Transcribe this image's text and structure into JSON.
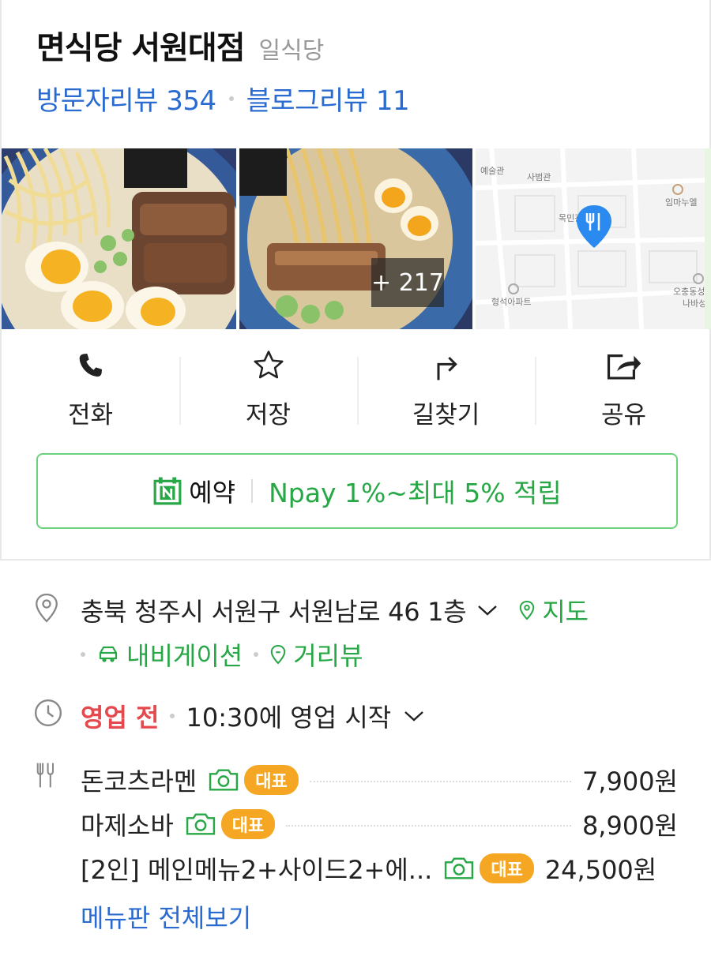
{
  "header": {
    "name": "면식당 서원대점",
    "category": "일식당",
    "visitor_reviews": "방문자리뷰 354",
    "blog_reviews": "블로그리뷰 11"
  },
  "photos": {
    "more_count": "+ 217",
    "map_labels": [
      "예술관",
      "사범관",
      "목민관",
      "임마누엘",
      "형석아파트",
      "오충동성",
      "나바성"
    ]
  },
  "actions": [
    {
      "label": "전화",
      "icon": "phone-icon"
    },
    {
      "label": "저장",
      "icon": "star-icon"
    },
    {
      "label": "길찾기",
      "icon": "directions-icon"
    },
    {
      "label": "공유",
      "icon": "share-icon"
    }
  ],
  "reservation": {
    "label": "예약",
    "npay": "Npay 1%~최대 5% 적립"
  },
  "address": {
    "text": "충북 청주시 서원구 서원남로 46 1층",
    "map_link": "지도",
    "navigation": "내비게이션",
    "street_view": "거리뷰"
  },
  "hours": {
    "status": "영업 전",
    "detail": "10:30에 영업 시작"
  },
  "menu": {
    "badge": "대표",
    "items": [
      {
        "name": "돈코츠라멘",
        "price": "7,900원"
      },
      {
        "name": "마제소바",
        "price": "8,900원"
      },
      {
        "name": "[2인] 메인메뉴2+사이드2+에...",
        "price": "24,500원"
      }
    ],
    "view_all": "메뉴판 전체보기"
  },
  "colors": {
    "link_blue": "#2a6bd1",
    "naver_green": "#27a745",
    "status_red": "#e5484d",
    "badge_orange": "#f5a623"
  }
}
